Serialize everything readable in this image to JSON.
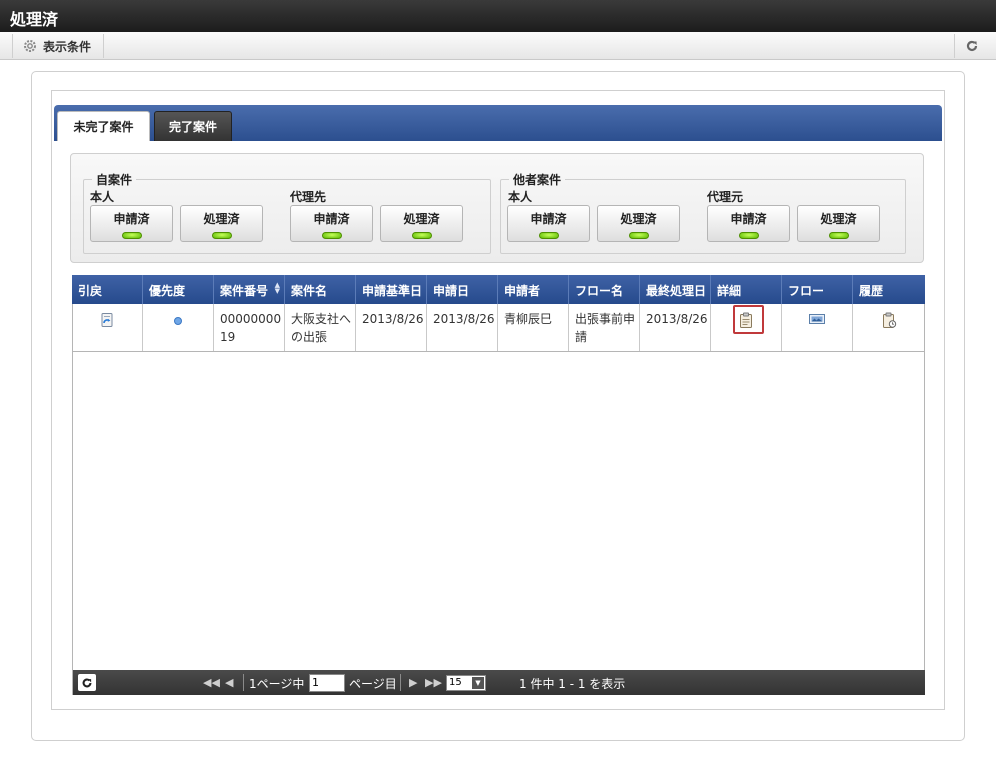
{
  "window": {
    "title": "処理済"
  },
  "toolbar": {
    "condition_label": "表示条件"
  },
  "tabs": [
    {
      "label": "未完了案件"
    },
    {
      "label": "完了案件"
    }
  ],
  "filter": {
    "own": {
      "legend": "自案件",
      "groups": [
        {
          "label": "本人",
          "buttons": [
            "申請済",
            "処理済"
          ]
        },
        {
          "label": "代理先",
          "buttons": [
            "申請済",
            "処理済"
          ]
        }
      ]
    },
    "others": {
      "legend": "他者案件",
      "groups": [
        {
          "label": "本人",
          "buttons": [
            "申請済",
            "処理済"
          ]
        },
        {
          "label": "代理元",
          "buttons": [
            "申請済",
            "処理済"
          ]
        }
      ]
    }
  },
  "table": {
    "columns": [
      "引戻",
      "優先度",
      "案件番号",
      "案件名",
      "申請基準日",
      "申請日",
      "申請者",
      "フロー名",
      "最終処理日",
      "詳細",
      "フロー",
      "履歴"
    ],
    "rows": [
      {
        "matter_number": "0000000019",
        "matter_name": "大阪支社への出張",
        "apply_base_date": "2013/8/26",
        "apply_date": "2013/8/26",
        "applicant": "青柳辰巳",
        "flow_name": "出張事前申請",
        "last_processed": "2013/8/26"
      }
    ]
  },
  "pager": {
    "page_prefix": "1ページ中",
    "current_page": "1",
    "page_suffix": "ページ目",
    "page_size": "15",
    "summary": "1 件中 1 - 1 を表示"
  }
}
